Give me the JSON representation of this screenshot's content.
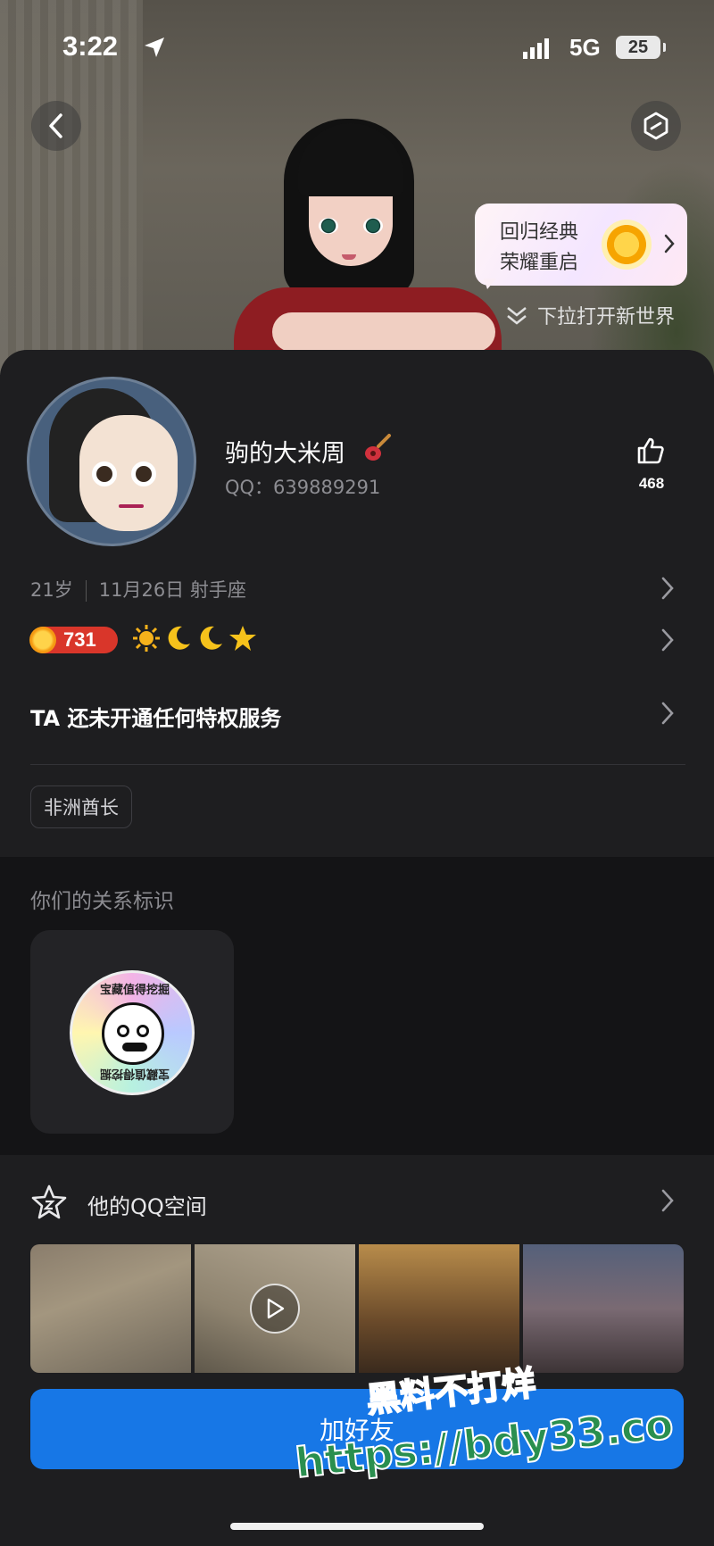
{
  "status_bar": {
    "time": "3:22",
    "network": "5G",
    "battery": "25"
  },
  "promo": {
    "line1": "回归经典",
    "line2": "荣耀重启"
  },
  "pull_hint": "下拉打开新世界",
  "profile": {
    "nickname": "驹的大米周",
    "qq_label": "QQ：639889291",
    "like_count": "468",
    "age": "21岁",
    "birthday": "11月26日",
    "zodiac": "射手座",
    "level": "731",
    "privilege_text": "TA 还未开通任何特权服务",
    "tag": "非洲酋长"
  },
  "relation": {
    "title": "你们的关系标识",
    "badge_text": "宝藏值得挖掘"
  },
  "qzone": {
    "title": "他的QQ空间"
  },
  "add_friend_label": "加好友",
  "watermark": {
    "line1": "黑料不打烊",
    "line2": "https://bdy33.co"
  },
  "icons": {
    "location": "location-arrow-icon",
    "back": "back-chevron-icon",
    "more": "hexagon-minus-icon",
    "like": "thumbs-up-icon",
    "qzone": "star-icon",
    "play": "play-icon"
  },
  "colors": {
    "primary_button": "#1777e6",
    "level_badge": "#d9362a"
  }
}
